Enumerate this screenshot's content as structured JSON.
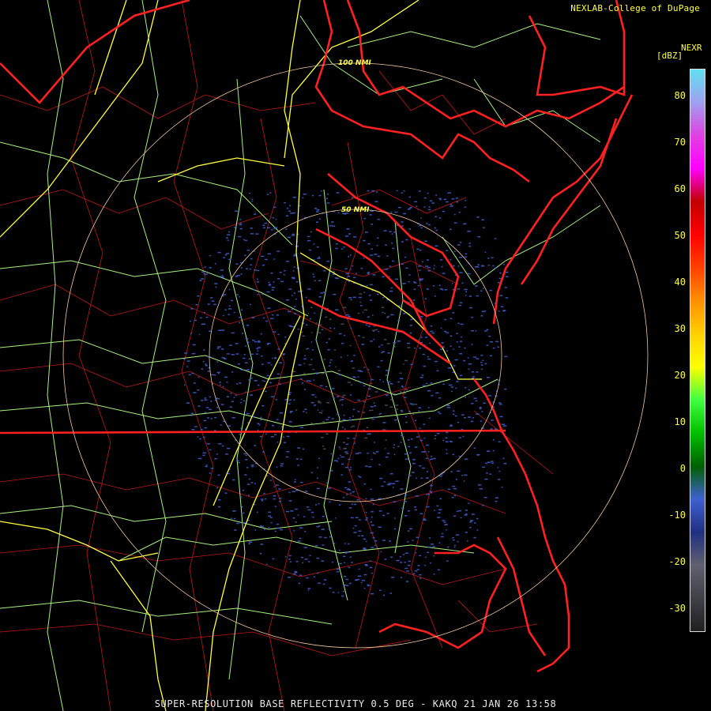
{
  "credit": "NEXLAB-College of DuPage",
  "legend": {
    "title": "NEXR",
    "unit": "[dBZ]",
    "ticks": [
      "80",
      "70",
      "60",
      "50",
      "40",
      "30",
      "20",
      "10",
      "0",
      "-10",
      "-20",
      "-30"
    ]
  },
  "rings": [
    "100 NMI",
    "50 NMI"
  ],
  "footer": "SUPER-RESOLUTION BASE REFLECTIVITY 0.5 DEG - KAKQ 21 JAN 26 13:58",
  "colors": {
    "state_border": "#ff2020",
    "county_border": "#c01818",
    "interstate": "#ffff40",
    "highway": "#a8f080",
    "ring": "#f0c8a0",
    "echo_light": "#4060d0",
    "echo_dark": "#505060"
  },
  "scale_colors": [
    "#60e0f0",
    "#a0a0f0",
    "#e040e0",
    "#ff00ff",
    "#c00000",
    "#ff0000",
    "#ff4000",
    "#ff9000",
    "#ffd000",
    "#ffff00",
    "#40ff40",
    "#00c000",
    "#006000",
    "#4060d0",
    "#203080",
    "#606070",
    "#404048",
    "#202020"
  ]
}
